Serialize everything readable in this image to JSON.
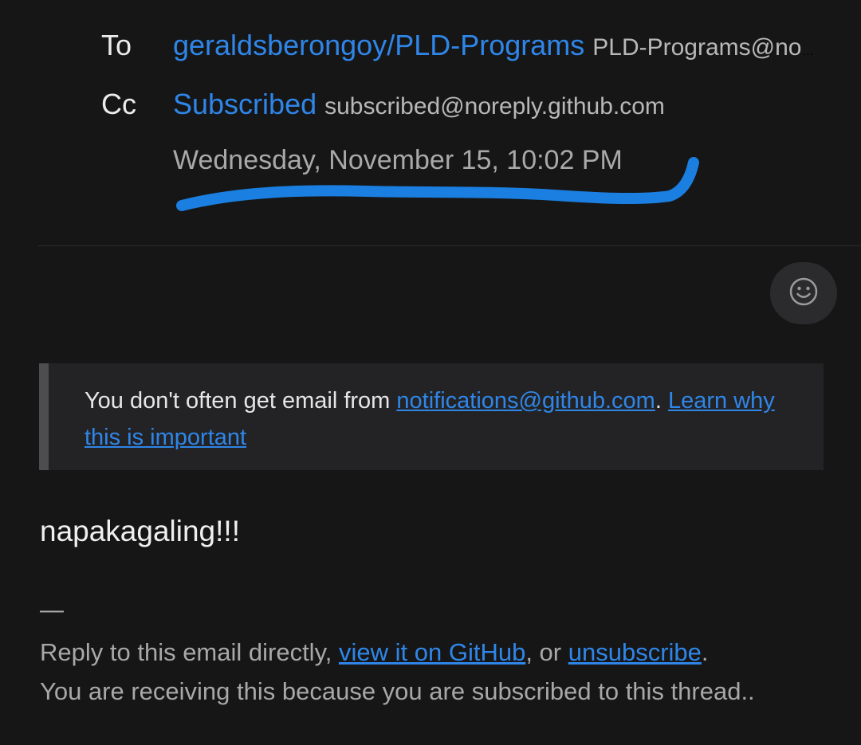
{
  "header": {
    "to": {
      "label": "To",
      "name": "geraldsberongoy/PLD-Programs",
      "email": "PLD-Programs@noreply.github.com"
    },
    "cc": {
      "label": "Cc",
      "name": "Subscribed",
      "email": "subscribed@noreply.github.com"
    },
    "date": "Wednesday, November 15, 10:02 PM"
  },
  "notice": {
    "prefix": "You don't often get email from ",
    "sender_link": "notifications@github.com",
    "period": ". ",
    "learn_link": "Learn why this is important"
  },
  "message": {
    "body": "napakagaling!!!",
    "signature_dash": "—",
    "footer_prefix": "Reply to this email directly, ",
    "view_link": "view it on GitHub",
    "or_text": ", or ",
    "unsubscribe_link": "unsubscribe",
    "end_period": ".",
    "receiving_text": "You are receiving this because you are subscribed to this thread.."
  },
  "colors": {
    "background": "#161617",
    "link": "#2f86e8",
    "annotation": "#1a7fe0"
  },
  "icons": {
    "reaction": "smiley-face-icon"
  }
}
